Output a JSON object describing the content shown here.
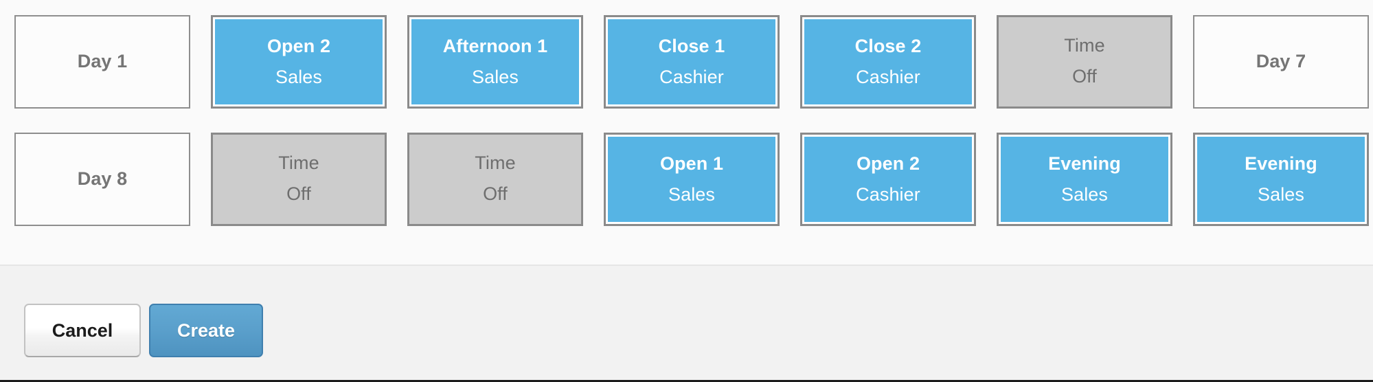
{
  "schedule": {
    "rows": [
      {
        "cards": [
          {
            "kind": "day",
            "title": "Day 1",
            "sub": ""
          },
          {
            "kind": "shift",
            "title": "Open 2",
            "sub": "Sales"
          },
          {
            "kind": "shift",
            "title": "Afternoon 1",
            "sub": "Sales"
          },
          {
            "kind": "shift",
            "title": "Close 1",
            "sub": "Cashier"
          },
          {
            "kind": "shift",
            "title": "Close 2",
            "sub": "Cashier"
          },
          {
            "kind": "off",
            "title": "Time",
            "sub": "Off"
          },
          {
            "kind": "day",
            "title": "Day 7",
            "sub": ""
          }
        ]
      },
      {
        "cards": [
          {
            "kind": "day",
            "title": "Day 8",
            "sub": ""
          },
          {
            "kind": "off",
            "title": "Time",
            "sub": "Off"
          },
          {
            "kind": "off",
            "title": "Time",
            "sub": "Off"
          },
          {
            "kind": "shift",
            "title": "Open 1",
            "sub": "Sales"
          },
          {
            "kind": "shift",
            "title": "Open 2",
            "sub": "Cashier"
          },
          {
            "kind": "shift",
            "title": "Evening",
            "sub": "Sales"
          },
          {
            "kind": "shift",
            "title": "Evening",
            "sub": "Sales"
          }
        ]
      }
    ]
  },
  "footer": {
    "cancel_label": "Cancel",
    "create_label": "Create"
  },
  "colors": {
    "shift_blue": "#56b4e4",
    "time_off_grey": "#cccccc",
    "card_border": "#8a8a8a",
    "create_button_blue": "#5a9fcb",
    "canvas_background": "#fafafa",
    "footer_background": "#f2f2f2",
    "day_label_text": "#757575",
    "time_off_text": "#6e6e6e"
  }
}
